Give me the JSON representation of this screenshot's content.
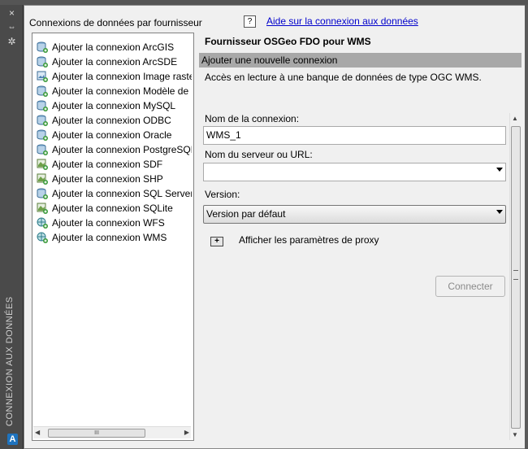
{
  "palette": {
    "title": "CONNEXION AUX DONNÉES",
    "close_icon": "×",
    "pin_icon": "⇔",
    "settings_icon": "✲",
    "logo_text": "A"
  },
  "left_panel": {
    "title": "Connexions de données par fournisseur",
    "items": [
      {
        "label": "Ajouter la connexion ArcGIS",
        "icon": "db-connection-icon"
      },
      {
        "label": "Ajouter la connexion ArcSDE",
        "icon": "db-connection-icon"
      },
      {
        "label": "Ajouter la connexion Image raster",
        "icon": "image-connection-icon"
      },
      {
        "label": "Ajouter la connexion Modèle de données",
        "icon": "db-connection-icon"
      },
      {
        "label": "Ajouter la connexion MySQL",
        "icon": "db-connection-icon"
      },
      {
        "label": "Ajouter la connexion ODBC",
        "icon": "db-connection-icon"
      },
      {
        "label": "Ajouter la connexion Oracle",
        "icon": "db-connection-icon"
      },
      {
        "label": "Ajouter la connexion PostgreSQL",
        "icon": "db-connection-icon"
      },
      {
        "label": "Ajouter la connexion SDF",
        "icon": "file-connection-icon"
      },
      {
        "label": "Ajouter la connexion SHP",
        "icon": "file-connection-icon"
      },
      {
        "label": "Ajouter la connexion SQL Server",
        "icon": "db-connection-icon"
      },
      {
        "label": "Ajouter la connexion SQLite",
        "icon": "file-connection-icon"
      },
      {
        "label": "Ajouter la connexion WFS",
        "icon": "web-connection-icon"
      },
      {
        "label": "Ajouter la connexion WMS",
        "icon": "web-connection-icon"
      }
    ],
    "scroll_grip": "III"
  },
  "help": {
    "icon_text": "?",
    "link_text": "Aide sur la connexion aux données"
  },
  "form": {
    "provider_title": "Fournisseur OSGeo FDO pour WMS",
    "section_header": "Ajouter une nouvelle connexion",
    "description": "Accès en lecture à une banque de données de type OGC WMS.",
    "name_label": "Nom de la connexion:",
    "name_value": "WMS_1",
    "server_label": "Nom du serveur ou URL:",
    "server_value": "",
    "version_label": "Version:",
    "version_value": "Version par défaut",
    "proxy_toggle": "+",
    "proxy_label": "Afficher les paramètres de proxy",
    "connect_button": "Connecter"
  },
  "colors": {
    "section_header_bg": "#a8a8a8",
    "link": "#0000cc",
    "palette_bg": "#4a4a4a"
  }
}
